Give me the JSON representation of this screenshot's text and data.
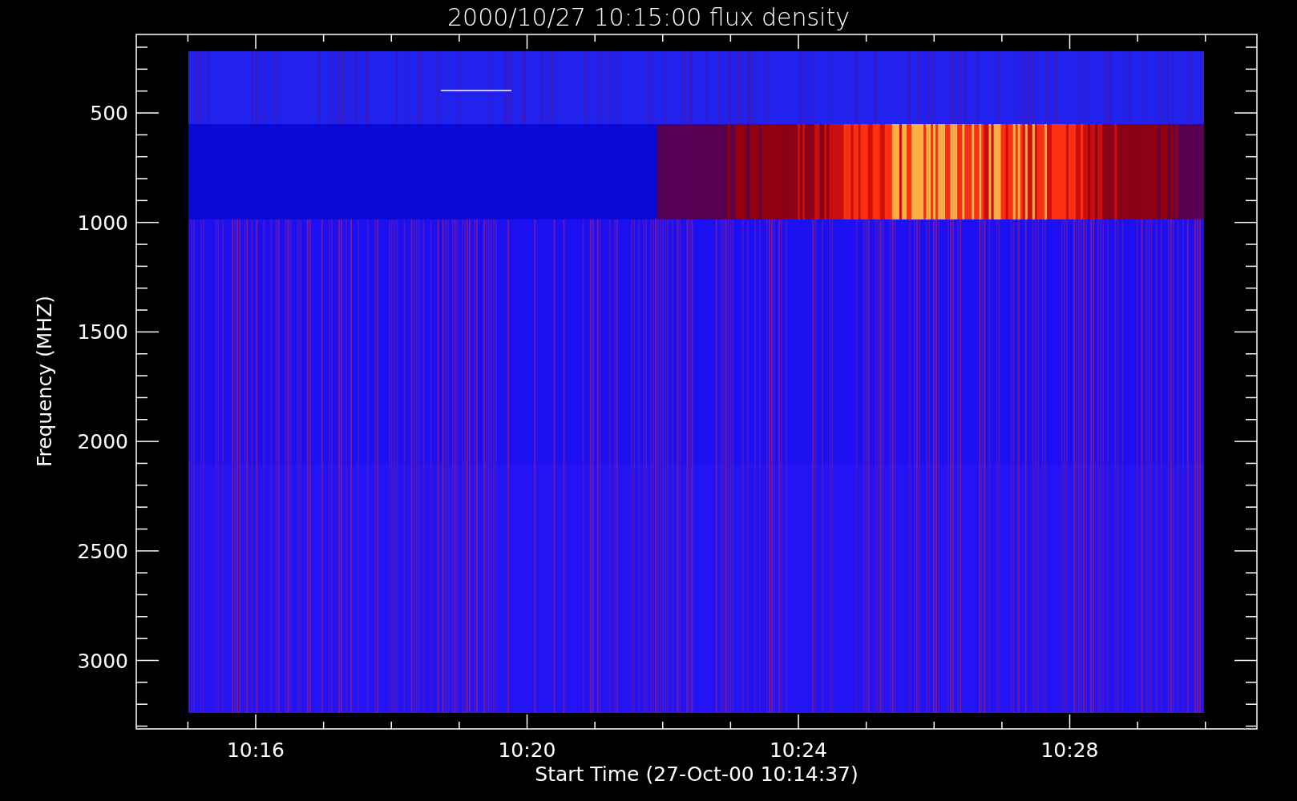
{
  "title": "2000/10/27 10:15:00 flux density",
  "x_axis": {
    "label": "Start Time (27-Oct-00 10:14:37)",
    "ticks": [
      "10:16",
      "10:20",
      "10:24",
      "10:28"
    ]
  },
  "y_axis": {
    "label": "Frequency (MHZ)",
    "ticks": [
      "500",
      "1000",
      "1500",
      "2000",
      "2500",
      "3000"
    ]
  }
}
